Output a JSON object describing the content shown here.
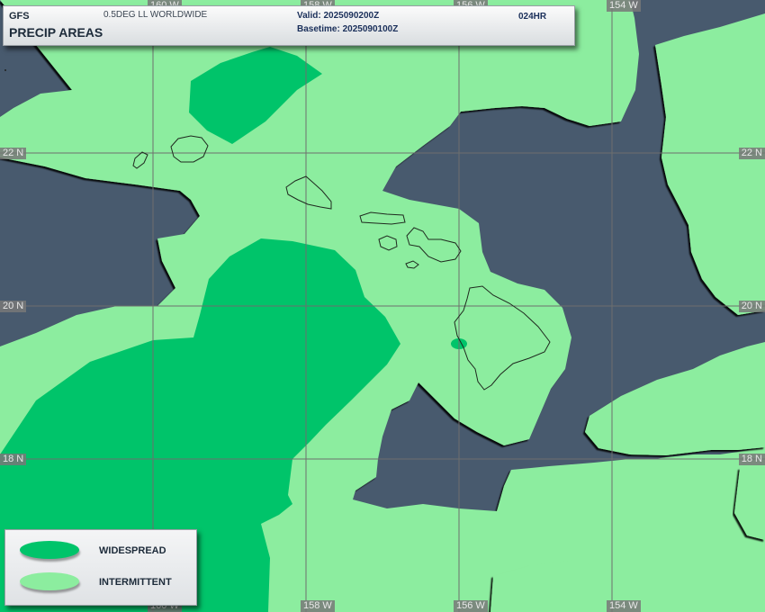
{
  "header": {
    "model": "GFS",
    "grid": "0.5DEG LL WORLDWIDE",
    "product": "PRECIP AREAS",
    "valid": "Valid: 2025090200Z",
    "basetime": "Basetime: 2025090100Z",
    "forecast_hour": "024HR"
  },
  "colors": {
    "ocean": "#485a6e",
    "intermittent": "#8ced9f",
    "widespread": "#00c46a",
    "coastline": "#1f2a1f"
  },
  "grid_labels": {
    "lat_22": "22 N",
    "lat_20": "20 N",
    "lat_18": "18 N",
    "lon_160": "160 W",
    "lon_158": "158 W",
    "lon_156": "156 W",
    "lon_154": "154 W"
  },
  "legend": {
    "widespread": "WIDESPREAD",
    "intermittent": "INTERMITTENT"
  }
}
